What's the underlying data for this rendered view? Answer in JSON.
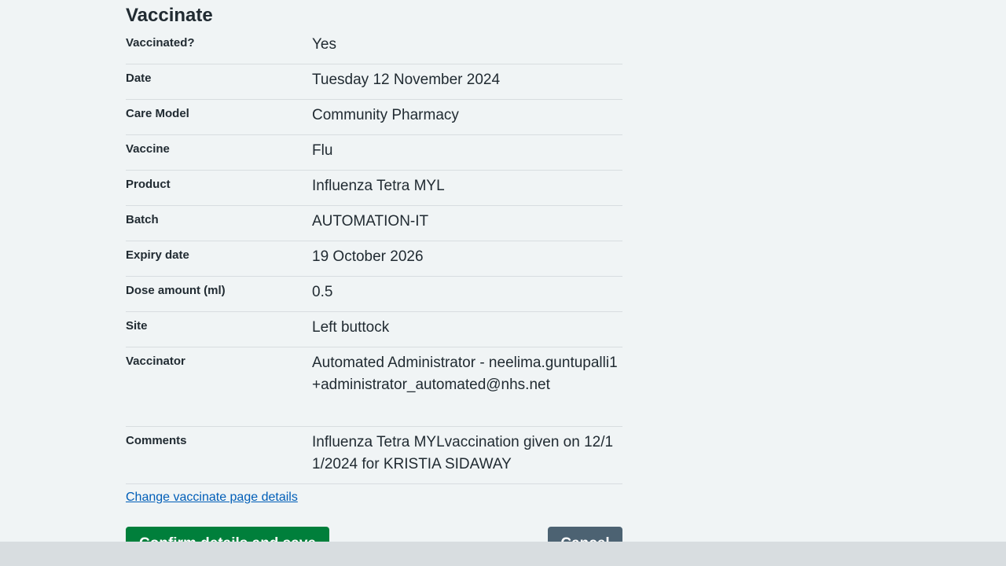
{
  "page": {
    "title": "Vaccinate"
  },
  "summary": [
    {
      "key": "Vaccinated?",
      "value": "Yes"
    },
    {
      "key": "Date",
      "value": "Tuesday 12 November 2024"
    },
    {
      "key": "Care Model",
      "value": "Community Pharmacy"
    },
    {
      "key": "Vaccine",
      "value": "Flu"
    },
    {
      "key": "Product",
      "value": "Influenza Tetra MYL"
    },
    {
      "key": "Batch",
      "value": "AUTOMATION-IT"
    },
    {
      "key": "Expiry date",
      "value": "19 October 2026"
    },
    {
      "key": "Dose amount (ml)",
      "value": "0.5"
    },
    {
      "key": "Site",
      "value": "Left buttock"
    },
    {
      "key": "Vaccinator",
      "value": "Automated Administrator - neelima.guntupalli1+administrator_automated@nhs.net"
    },
    {
      "key": "Comments",
      "value": "Influenza Tetra MYLvaccination given on 12/11/2024 for KRISTIA SIDAWAY"
    }
  ],
  "actions": {
    "change_link": "Change vaccinate page details",
    "confirm_label": "Confirm details and save",
    "cancel_label": "Cancel"
  },
  "colors": {
    "background": "#f0f4f5",
    "link": "#005eb8",
    "confirm": "#007f3b",
    "cancel": "#4c6272"
  }
}
